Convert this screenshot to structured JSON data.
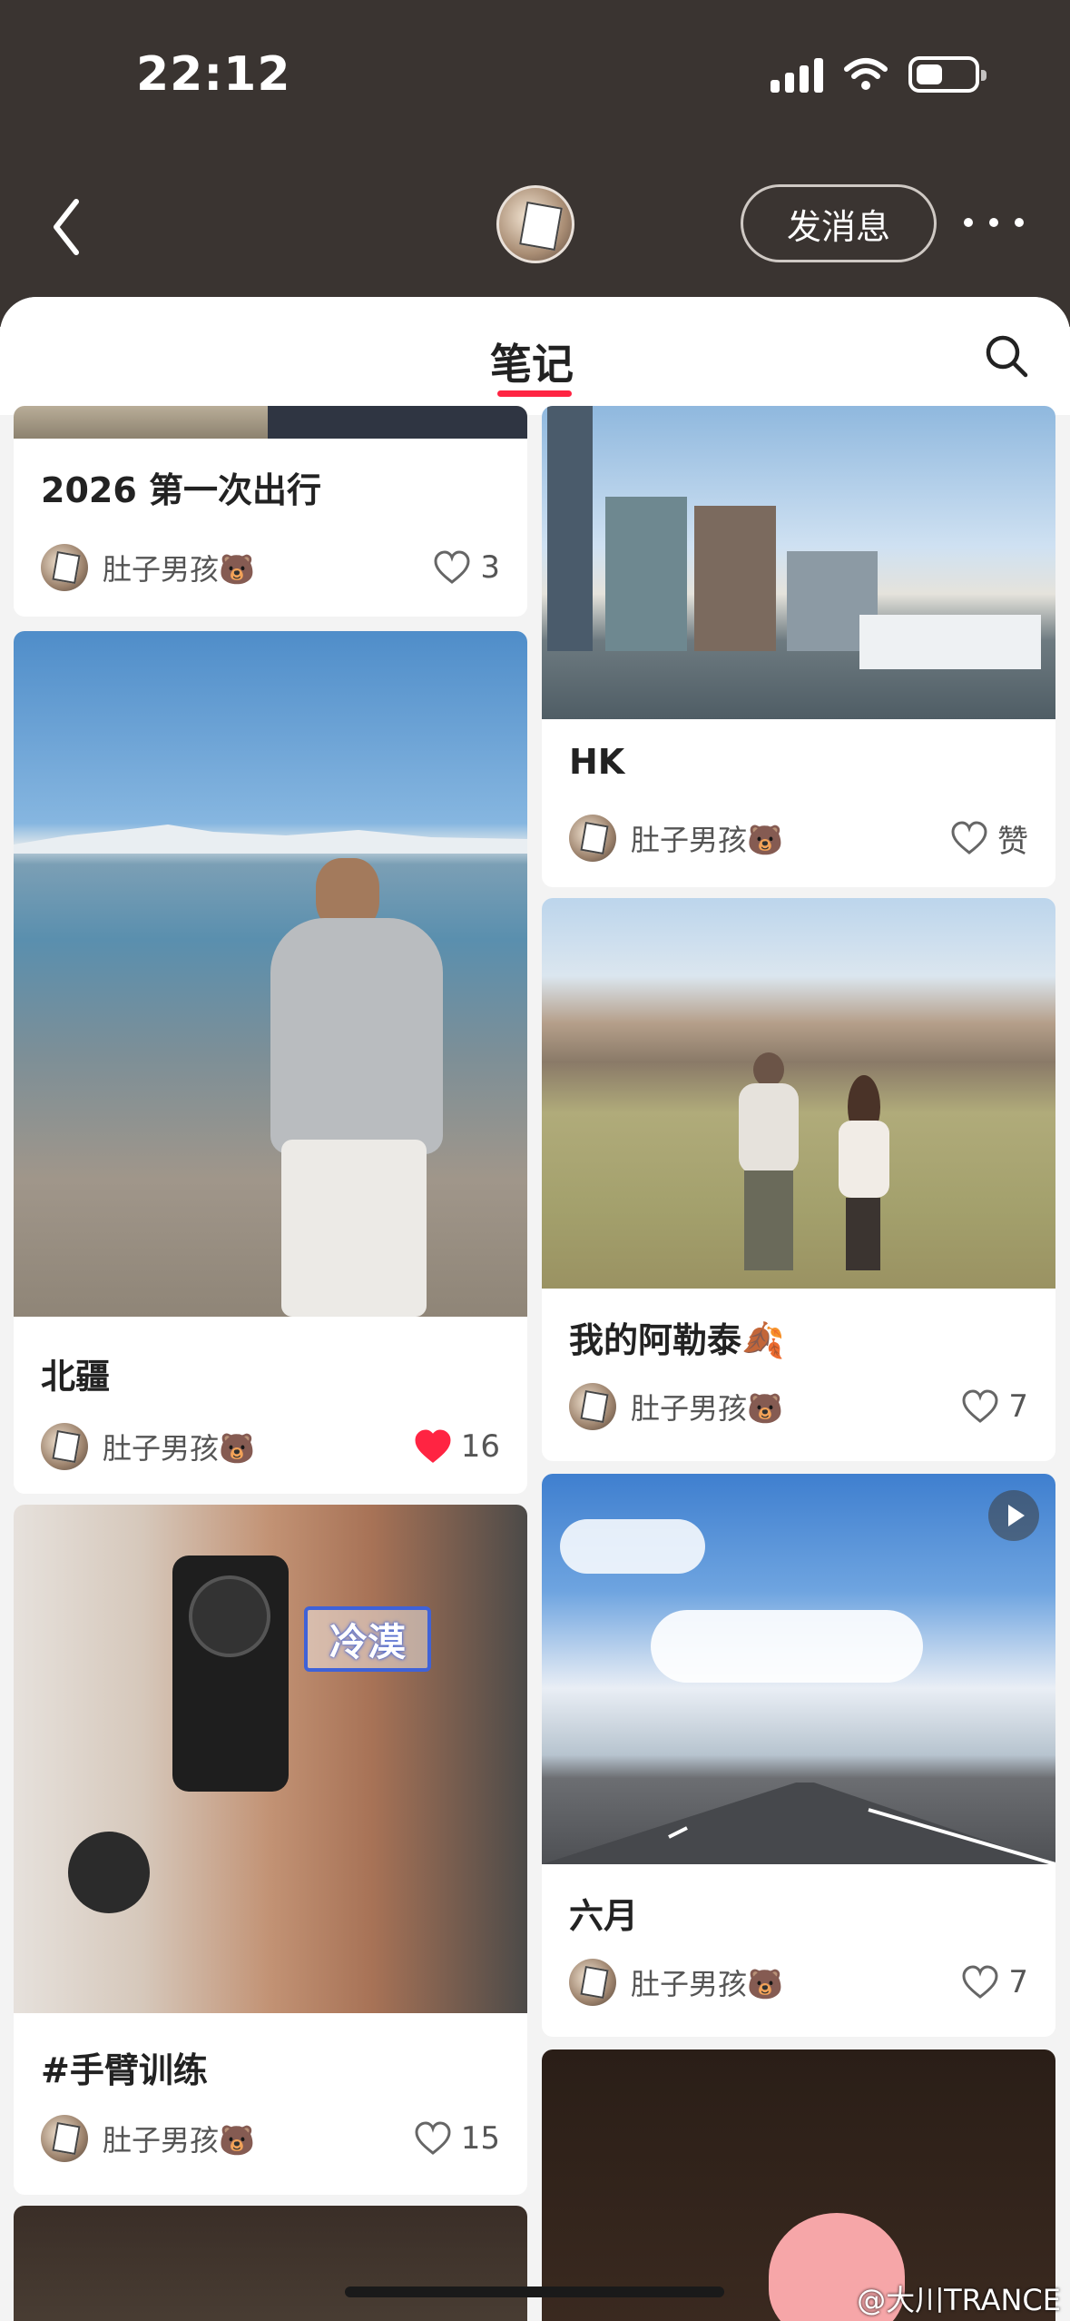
{
  "status": {
    "time": "22:12"
  },
  "header": {
    "message_button": "发消息"
  },
  "tabs": {
    "notes": "笔记"
  },
  "colors": {
    "accent": "#ff2442",
    "header_bg": "#3a3431"
  },
  "author": "肚子男孩🐻",
  "cards_left": [
    {
      "title": "2026 第一次出行",
      "likes": "3",
      "liked": false
    },
    {
      "title": "北疆",
      "likes": "16",
      "liked": true
    },
    {
      "title": "#手臂训练",
      "likes": "15",
      "liked": false
    }
  ],
  "cards_right": [
    {
      "title": "HK",
      "likes": "赞",
      "liked": false
    },
    {
      "title": "我的阿勒泰🍂",
      "likes": "7",
      "liked": false
    },
    {
      "title": "六月",
      "likes": "7",
      "liked": false
    }
  ],
  "sticker_text": "冷漠",
  "watermark": "@大川TRANCE",
  "icons": [
    "back-arrow-icon",
    "more-dots-icon",
    "search-icon",
    "heart-icon",
    "play-icon",
    "signal-icon",
    "wifi-icon",
    "battery-icon"
  ]
}
